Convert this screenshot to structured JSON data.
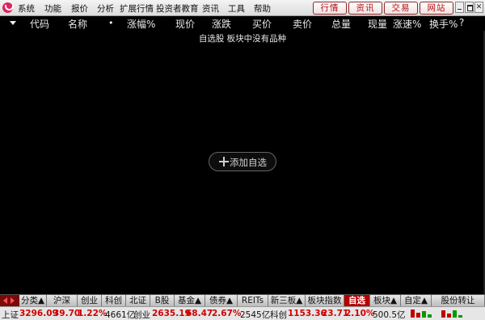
{
  "menu": {
    "items": [
      "系统",
      "功能",
      "报价",
      "分析",
      "扩展行情",
      "投资者教育",
      "资讯",
      "工具",
      "帮助"
    ],
    "top_buttons": [
      "行情",
      "资讯",
      "交易",
      "网站"
    ],
    "window_controls": {
      "minimize": "",
      "maximize": "",
      "close": "✕"
    }
  },
  "columns": [
    "代码",
    "名称",
    "涨幅%",
    "现价",
    "涨跌",
    "买价",
    "卖价",
    "总量",
    "现量",
    "涨速%",
    "换手%",
    "?"
  ],
  "header_marker": "•",
  "empty_message": "自选股 板块中没有品种",
  "add_button": "添加自选",
  "tabs": [
    {
      "label": "分类▲"
    },
    {
      "label": "沪深"
    },
    {
      "label": "创业"
    },
    {
      "label": "科创"
    },
    {
      "label": "北证"
    },
    {
      "label": "B股"
    },
    {
      "label": "基金▲"
    },
    {
      "label": "债券▲"
    },
    {
      "label": "REITs"
    },
    {
      "label": "新三板▲"
    },
    {
      "label": "板块指数"
    },
    {
      "label": "自选"
    },
    {
      "label": "板块▲"
    },
    {
      "label": "自定▲"
    },
    {
      "label": "股份转让"
    }
  ],
  "status": {
    "sh": {
      "label": "上证",
      "price": "3296.09",
      "change": "39.70",
      "pct": "1.22%",
      "volume": "4661亿"
    },
    "cy": {
      "label": "创业",
      "price": "2635.19",
      "change": "68.47",
      "pct": "2.67%",
      "volume": "2545亿"
    },
    "kc": {
      "label": "科创",
      "price": "1153.36",
      "change": "23.71",
      "pct": "2.10%",
      "volume": "500.5亿"
    }
  },
  "colors": {
    "accent_red": "#d00000",
    "tab_active": "#b30000",
    "background": "#000000"
  }
}
